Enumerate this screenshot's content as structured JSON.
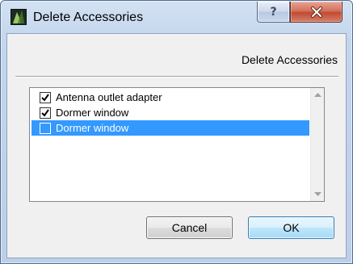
{
  "window": {
    "title": "Delete Accessories",
    "help_glyph": "?",
    "icons": {
      "app": "app-icon",
      "help": "help-icon",
      "close": "close-icon"
    }
  },
  "dialog": {
    "subtitle": "Delete Accessories",
    "items": [
      {
        "label": "Antenna outlet adapter",
        "checked": true,
        "selected": false
      },
      {
        "label": "Dormer window",
        "checked": true,
        "selected": false
      },
      {
        "label": "Dormer window",
        "checked": false,
        "selected": true
      }
    ],
    "buttons": {
      "cancel": "Cancel",
      "ok": "OK"
    }
  },
  "colors": {
    "selection": "#3399ff",
    "close_button": "#c24a33",
    "ok_button_border": "#3c7fb1"
  }
}
